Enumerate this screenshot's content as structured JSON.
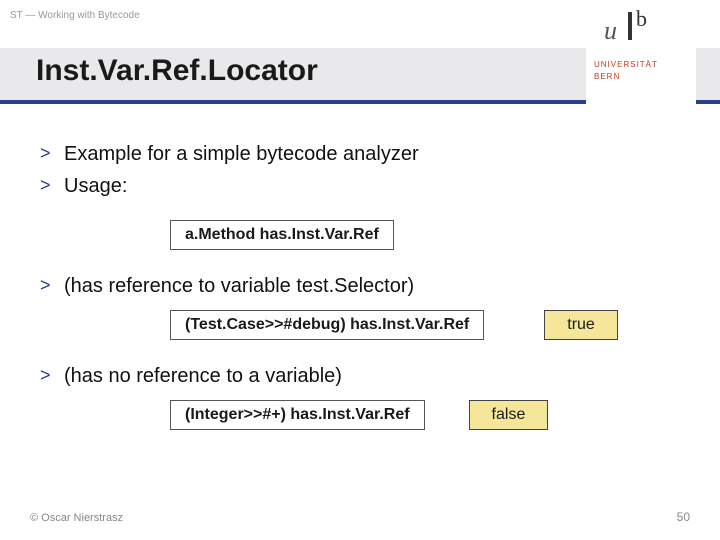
{
  "header": {
    "topLabel": "ST — Working with Bytecode",
    "title": "Inst.Var.Ref.Locator",
    "logo": {
      "u": "u",
      "b": "b",
      "line1": "UNIVERSITÄT",
      "line2": "BERN"
    }
  },
  "content": {
    "line1": "Example for a simple bytecode analyzer",
    "line2": "Usage:",
    "code1": "a.Method has.Inst.Var.Ref",
    "line3": "(has reference to variable test.Selector)",
    "code2": "(Test.Case>>#debug) has.Inst.Var.Ref",
    "result2": "true",
    "line4": "(has no reference to a variable)",
    "code3": "(Integer>>#+) has.Inst.Var.Ref",
    "result3": "false"
  },
  "footer": {
    "left": "© Oscar Nierstrasz",
    "pageNum": "50"
  }
}
